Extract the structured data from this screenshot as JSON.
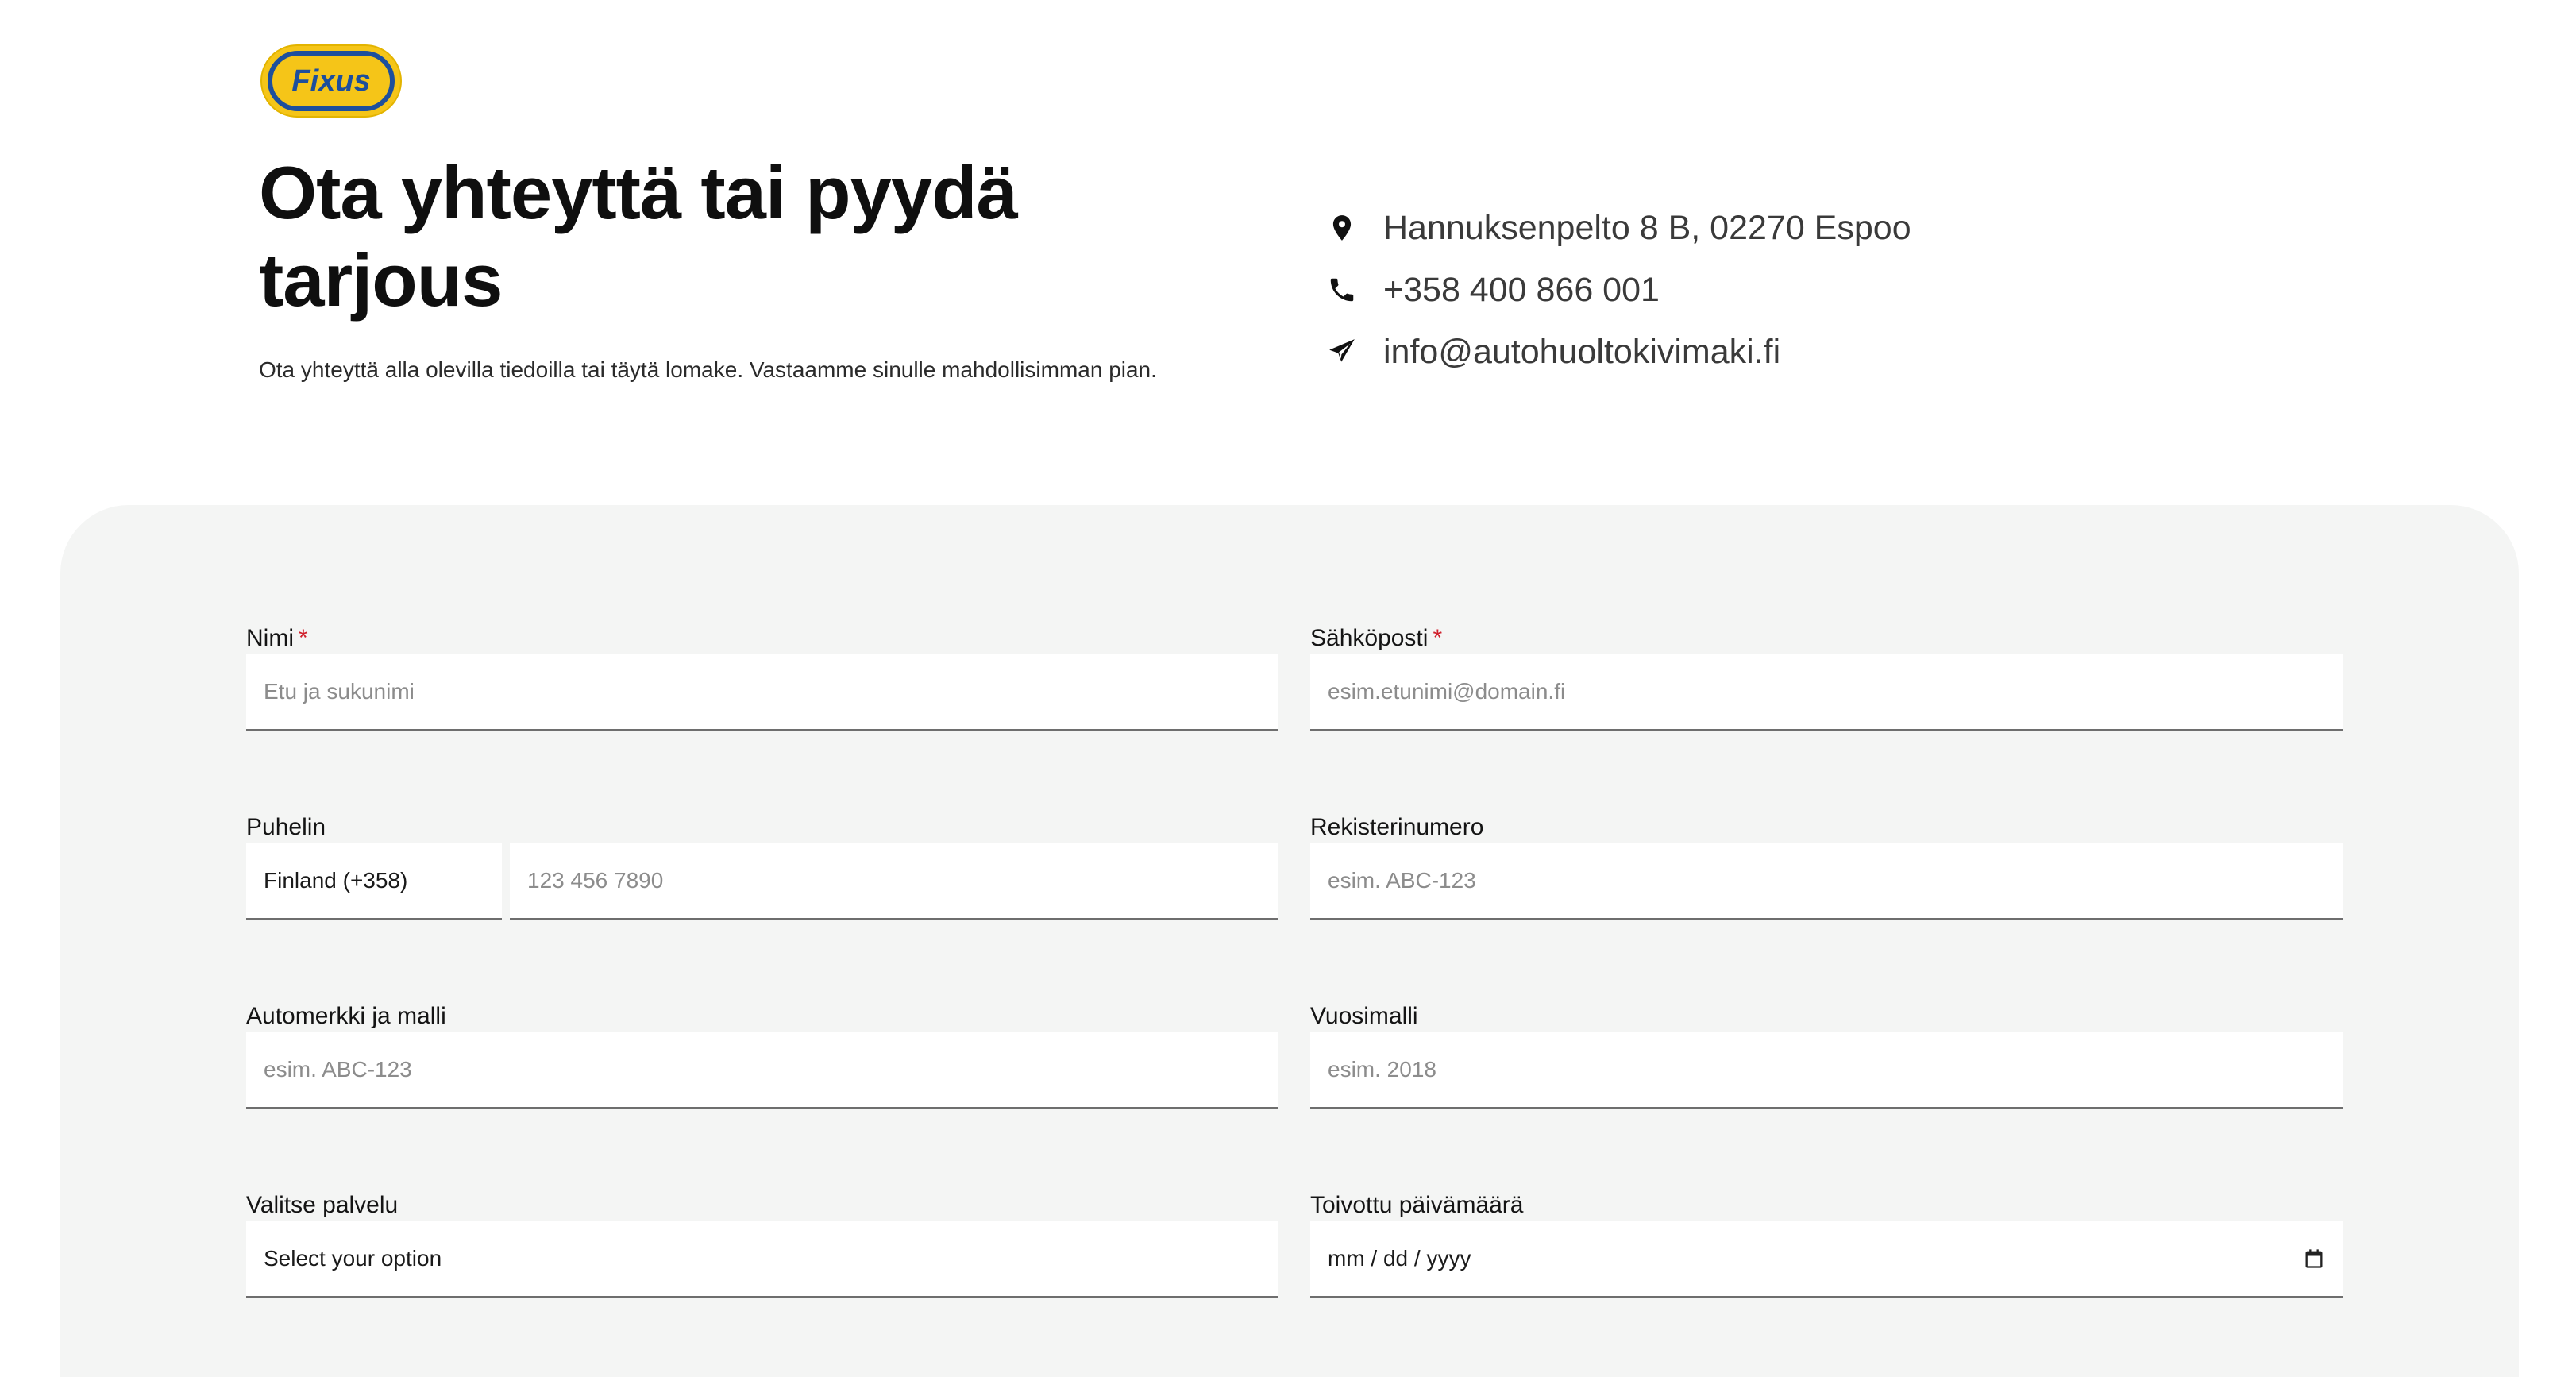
{
  "brand": {
    "logo_text": "Fixus"
  },
  "header": {
    "title": "Ota yhteyttä tai pyydä tarjous",
    "subtitle": "Ota yhteyttä alla olevilla tiedoilla tai täytä lomake. Vastaamme sinulle mahdollisimman pian."
  },
  "contact": {
    "address": {
      "icon": "location-pin-icon",
      "text": "Hannuksenpelto 8 B, 02270 Espoo"
    },
    "phone": {
      "icon": "phone-icon",
      "text": "+358 400 866 001"
    },
    "email": {
      "icon": "send-icon",
      "text": "info@autohuoltokivimaki.fi"
    }
  },
  "form": {
    "name": {
      "label": "Nimi",
      "required_mark": "*",
      "placeholder": "Etu ja sukunimi"
    },
    "email": {
      "label": "Sähköposti",
      "required_mark": "*",
      "placeholder": "esim.etunimi@domain.fi"
    },
    "phone": {
      "label": "Puhelin",
      "country_value": "Finland (+358)",
      "placeholder": "123 456 7890"
    },
    "registration": {
      "label": "Rekisterinumero",
      "placeholder": "esim. ABC-123"
    },
    "car_model": {
      "label": "Automerkki ja malli",
      "placeholder": "esim. ABC-123"
    },
    "year": {
      "label": "Vuosimalli",
      "placeholder": "esim. 2018"
    },
    "service": {
      "label": "Valitse palvelu",
      "value": "Select your option"
    },
    "date": {
      "label": "Toivottu päivämäärä",
      "value": "mm / dd / yyyy",
      "icon": "calendar-icon"
    }
  },
  "colors": {
    "panel_bg": "#f4f5f4",
    "required": "#d0202c",
    "logo_yellow": "#f5c518",
    "logo_blue": "#1d4f9c"
  }
}
